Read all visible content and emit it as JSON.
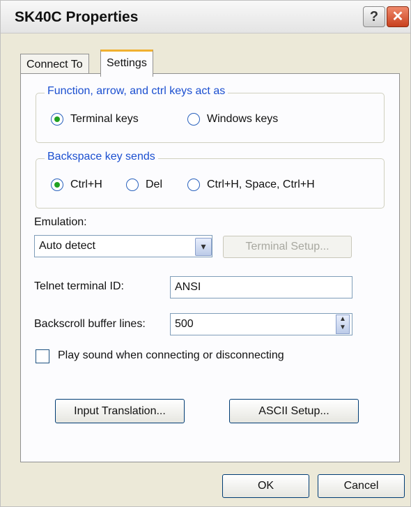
{
  "window": {
    "title": "SK40C Properties",
    "help_glyph": "?",
    "close_glyph": "✕"
  },
  "tabs": [
    {
      "label": "Connect To",
      "active": false
    },
    {
      "label": "Settings",
      "active": true
    }
  ],
  "function_keys": {
    "legend": "Function, arrow, and ctrl keys act as",
    "options": [
      {
        "label": "Terminal keys",
        "selected": true
      },
      {
        "label": "Windows keys",
        "selected": false
      }
    ]
  },
  "backspace": {
    "legend": "Backspace key sends",
    "options": [
      {
        "label": "Ctrl+H",
        "selected": true
      },
      {
        "label": "Del",
        "selected": false
      },
      {
        "label": "Ctrl+H, Space, Ctrl+H",
        "selected": false
      }
    ]
  },
  "emulation": {
    "label": "Emulation:",
    "value": "Auto detect",
    "setup_button": "Terminal Setup..."
  },
  "telnet_id": {
    "label": "Telnet terminal ID:",
    "value": "ANSI"
  },
  "backscroll": {
    "label": "Backscroll buffer lines:",
    "value": "500"
  },
  "play_sound": {
    "label": "Play sound when connecting or disconnecting",
    "checked": false
  },
  "buttons": {
    "input_translation": "Input Translation...",
    "ascii_setup": "ASCII Setup...",
    "ok": "OK",
    "cancel": "Cancel"
  },
  "icons": {
    "dropdown": "chevron-down-icon",
    "spin": "spin-arrows-icon",
    "help": "help-icon",
    "close": "close-icon"
  },
  "colors": {
    "accent_tab": "#f0b030",
    "legend_text": "#1b4fd0",
    "radio_selected": "#21a121",
    "close_button": "#c8401e"
  }
}
